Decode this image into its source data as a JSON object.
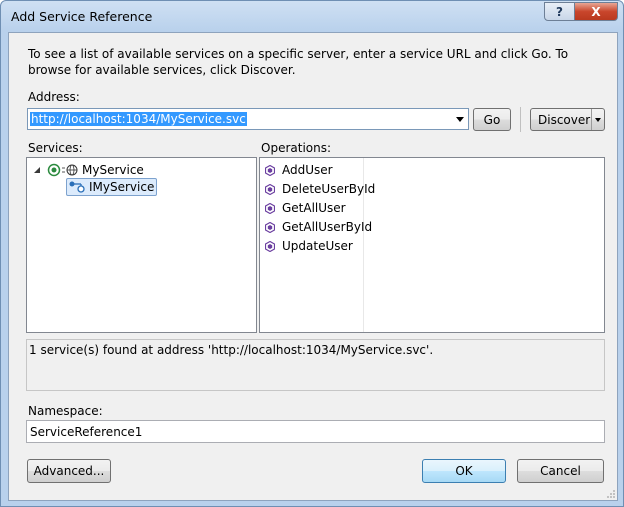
{
  "window": {
    "title": "Add Service Reference",
    "help_label": "?",
    "close_label": "X"
  },
  "intro_text": "To see a list of available services on a specific server, enter a service URL and click Go. To browse for available services, click Discover.",
  "address": {
    "label": "Address:",
    "value": "http://localhost:1034/MyService.svc"
  },
  "buttons": {
    "go": "Go",
    "discover": "Discover",
    "advanced": "Advanced...",
    "ok": "OK",
    "cancel": "Cancel"
  },
  "services": {
    "label": "Services:",
    "root": "MyService",
    "child": "IMyService"
  },
  "operations": {
    "label": "Operations:",
    "items": [
      "AddUser",
      "DeleteUserById",
      "GetAllUser",
      "GetAllUserById",
      "UpdateUser"
    ]
  },
  "status_text": "1 service(s) found at address 'http://localhost:1034/MyService.svc'.",
  "namespace": {
    "label": "Namespace:",
    "value": "ServiceReference1"
  },
  "colors": {
    "selection": "#3399ff",
    "method_icon": "#6b3fa0",
    "close_button": "#c9462c"
  }
}
